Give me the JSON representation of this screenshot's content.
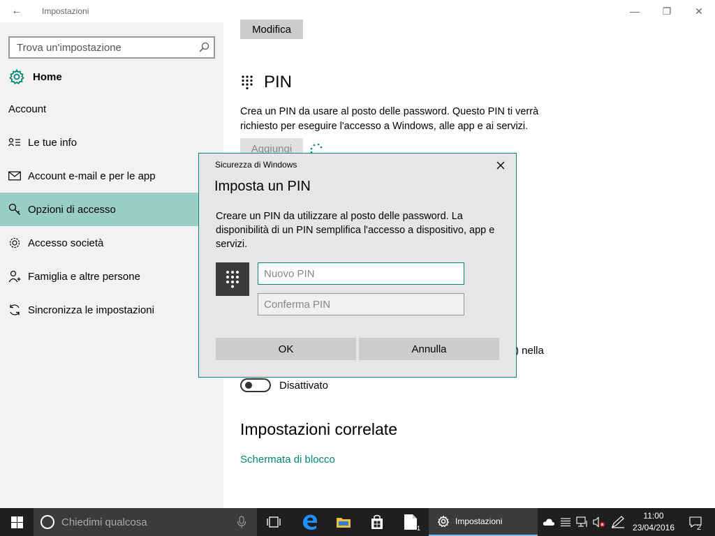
{
  "window": {
    "title": "Impostazioni",
    "back_glyph": "←",
    "min_glyph": "—",
    "max_glyph": "❐",
    "close_glyph": "✕"
  },
  "sidebar": {
    "search_placeholder": "Trova un'impostazione",
    "home_label": "Home",
    "section_label": "Account",
    "items": [
      {
        "label": "Le tue info",
        "icon": "user-info-icon"
      },
      {
        "label": "Account e-mail e per le app",
        "icon": "mail-icon"
      },
      {
        "label": "Opzioni di accesso",
        "icon": "key-icon",
        "active": true
      },
      {
        "label": "Accesso società",
        "icon": "briefcase-icon"
      },
      {
        "label": "Famiglia e altre persone",
        "icon": "person-add-icon"
      },
      {
        "label": "Sincronizza le impostazioni",
        "icon": "sync-icon"
      }
    ]
  },
  "main": {
    "modifica_label": "Modifica",
    "pin_title": "PIN",
    "pin_description": "Crea un PIN da usare al posto delle password. Questo PIN ti verrà richiesto per eseguire l'accesso a Windows, alle app e ai servizi.",
    "aggiungi_label": "Aggiungi",
    "partial_text": ") nella",
    "toggle_label": "Disattivato",
    "related_title": "Impostazioni correlate",
    "related_link": "Schermata di blocco"
  },
  "dialog": {
    "caption": "Sicurezza di Windows",
    "title": "Imposta un PIN",
    "description": "Creare un PIN da utilizzare al posto delle password. La disponibilità di un PIN semplifica l'accesso a dispositivo, app e servizi.",
    "new_pin_placeholder": "Nuovo PIN",
    "confirm_pin_placeholder": "Conferma PIN",
    "ok_label": "OK",
    "cancel_label": "Annulla"
  },
  "taskbar": {
    "search_placeholder": "Chiedimi qualcosa",
    "settings_label": "Impostazioni",
    "files_badge": "1",
    "time": "11:00",
    "date": "23/04/2016",
    "notification_count": "2"
  },
  "colors": {
    "accent": "#008575",
    "active_nav": "#99cdc7",
    "taskbar": "#1f1f1f",
    "edge_blue": "#1e90ff"
  }
}
